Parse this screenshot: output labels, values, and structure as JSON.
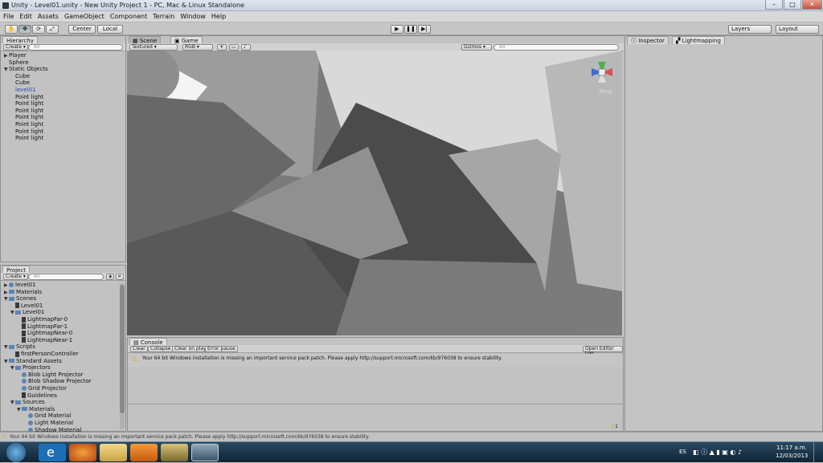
{
  "window": {
    "title": "Unity - Level01.unity - New Unity Project 1 - PC, Mac & Linux Standalone",
    "min": "–",
    "max": "□",
    "close": "✕"
  },
  "menu": [
    "File",
    "Edit",
    "Assets",
    "GameObject",
    "Component",
    "Terrain",
    "Window",
    "Help"
  ],
  "toolbar": {
    "center": "Center",
    "local": "Local",
    "layers": "Layers",
    "layout": "Layout"
  },
  "hierarchy": {
    "tab": "Hierarchy",
    "create": "Create",
    "search": "All",
    "items": [
      {
        "label": "Player",
        "indent": 0,
        "arrow": "▶",
        "sel": false
      },
      {
        "label": "Sphere",
        "indent": 0,
        "arrow": "",
        "sel": false
      },
      {
        "label": "Static Objects",
        "indent": 0,
        "arrow": "▼",
        "sel": false
      },
      {
        "label": "Cube",
        "indent": 1,
        "arrow": "",
        "sel": false
      },
      {
        "label": "Cube",
        "indent": 1,
        "arrow": "",
        "sel": false
      },
      {
        "label": "level01",
        "indent": 1,
        "arrow": "",
        "sel": true
      },
      {
        "label": "Point light",
        "indent": 1,
        "arrow": "",
        "sel": false
      },
      {
        "label": "Point light",
        "indent": 1,
        "arrow": "",
        "sel": false
      },
      {
        "label": "Point light",
        "indent": 1,
        "arrow": "",
        "sel": false
      },
      {
        "label": "Point light",
        "indent": 1,
        "arrow": "",
        "sel": false
      },
      {
        "label": "Point light",
        "indent": 1,
        "arrow": "",
        "sel": false
      },
      {
        "label": "Point light",
        "indent": 1,
        "arrow": "",
        "sel": false
      },
      {
        "label": "Point light",
        "indent": 1,
        "arrow": "",
        "sel": false
      }
    ]
  },
  "project": {
    "tab": "Project",
    "create": "Create",
    "search": "All",
    "items": [
      {
        "label": "level01",
        "indent": 0,
        "arrow": "▶",
        "icon": "ball"
      },
      {
        "label": "Materials",
        "indent": 0,
        "arrow": "▶",
        "icon": "folder"
      },
      {
        "label": "Scenes",
        "indent": 0,
        "arrow": "▼",
        "icon": "folder"
      },
      {
        "label": "Level01",
        "indent": 1,
        "arrow": "",
        "icon": "doc"
      },
      {
        "label": "Level01",
        "indent": 1,
        "arrow": "▼",
        "icon": "folder"
      },
      {
        "label": "LightmapFar-0",
        "indent": 2,
        "arrow": "",
        "icon": "doc"
      },
      {
        "label": "LightmapFar-1",
        "indent": 2,
        "arrow": "",
        "icon": "doc"
      },
      {
        "label": "LightmapNear-0",
        "indent": 2,
        "arrow": "",
        "icon": "doc"
      },
      {
        "label": "LightmapNear-1",
        "indent": 2,
        "arrow": "",
        "icon": "doc"
      },
      {
        "label": "Scripts",
        "indent": 0,
        "arrow": "▼",
        "icon": "folder"
      },
      {
        "label": "firstPersonController",
        "indent": 1,
        "arrow": "",
        "icon": "doc"
      },
      {
        "label": "Standard Assets",
        "indent": 0,
        "arrow": "▼",
        "icon": "folder"
      },
      {
        "label": "Projectors",
        "indent": 1,
        "arrow": "▼",
        "icon": "folder"
      },
      {
        "label": "Blob Light Projector",
        "indent": 2,
        "arrow": "",
        "icon": "ball"
      },
      {
        "label": "Blob Shadow Projector",
        "indent": 2,
        "arrow": "",
        "icon": "ball"
      },
      {
        "label": "Grid Projector",
        "indent": 2,
        "arrow": "",
        "icon": "ball"
      },
      {
        "label": "Guidelines",
        "indent": 2,
        "arrow": "",
        "icon": "doc"
      },
      {
        "label": "Sources",
        "indent": 1,
        "arrow": "▼",
        "icon": "folder"
      },
      {
        "label": "Materials",
        "indent": 2,
        "arrow": "▼",
        "icon": "folder"
      },
      {
        "label": "Grid Material",
        "indent": 3,
        "arrow": "",
        "icon": "ball"
      },
      {
        "label": "Light Material",
        "indent": 3,
        "arrow": "",
        "icon": "ball"
      },
      {
        "label": "Shadow Material",
        "indent": 3,
        "arrow": "",
        "icon": "ball"
      }
    ]
  },
  "scene": {
    "tab": "Scene",
    "game_tab": "Game",
    "shading": "Textured",
    "mode": "RGB",
    "gizmos": "Gizmos",
    "search": "All",
    "persp": "Persp"
  },
  "inspector": {
    "tab": "Inspector",
    "tab2": "Lightmapping"
  },
  "console": {
    "tab": "Console",
    "clear": "Clear",
    "collapse": "Collapse",
    "clear_play": "Clear on play",
    "error_pause": "Error pause",
    "open_log": "Open Editor Log",
    "message": "Your 64 bit Windows installation is missing an important service pack patch. Please apply http://support.microsoft.com/kb/976038 to ensure stability.",
    "count": "1"
  },
  "statusbar": {
    "message": "Your 64 bit Windows installation is missing an important service pack patch. Please apply http://support.microsoft.com/kb/976038 to ensure stability."
  },
  "taskbar": {
    "lang": "ES",
    "time": "11:17 a.m.",
    "date": "12/03/2013"
  }
}
